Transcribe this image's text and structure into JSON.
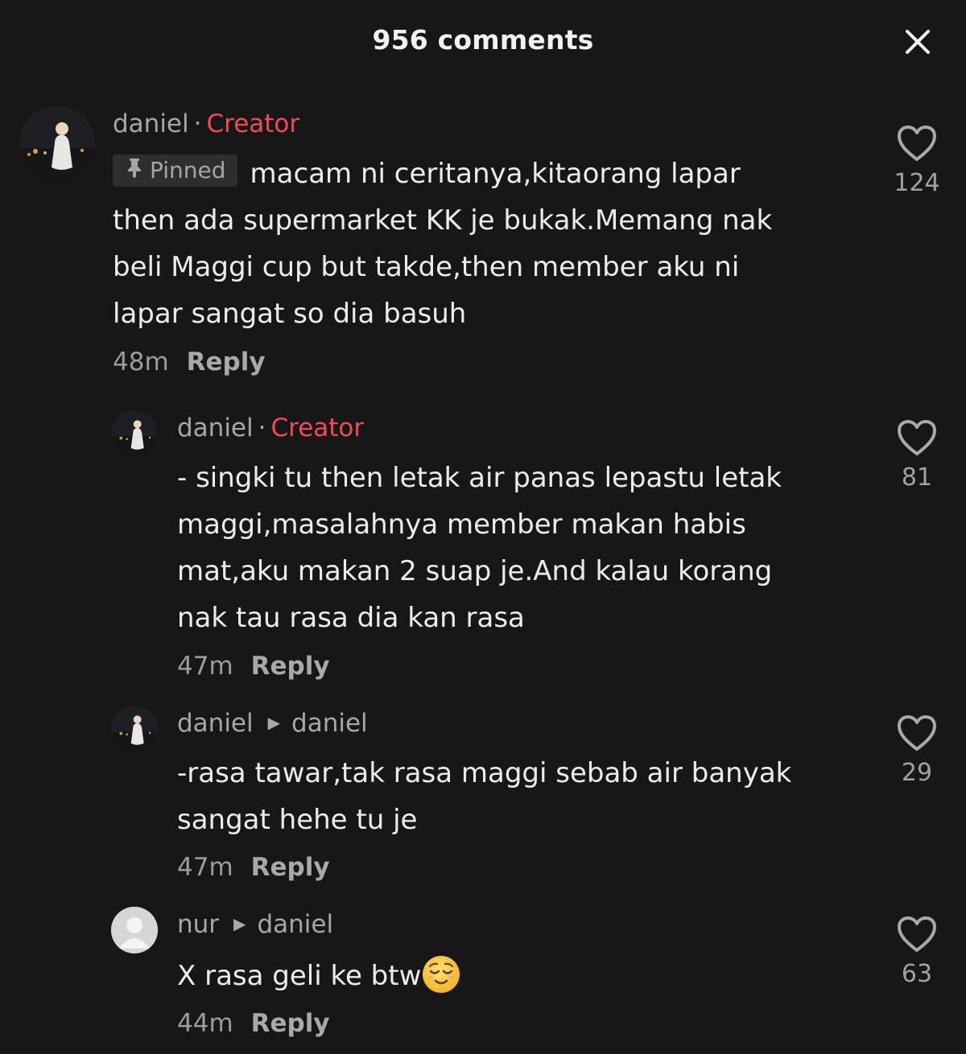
{
  "header": {
    "title": "956 comments",
    "close_icon": "close-icon"
  },
  "comments": [
    {
      "username": "daniel",
      "badge": "Creator",
      "pinned_label": "Pinned",
      "lines": [
        "macam ni ceritanya,kitaorang lapar",
        "then ada supermarket KK je bukak.Memang nak",
        "beli Maggi cup but takde,then member aku ni",
        "lapar sangat so dia basuh"
      ],
      "time": "48m",
      "reply_label": "Reply",
      "likes": "124"
    },
    {
      "username": "daniel",
      "badge": "Creator",
      "lines": [
        "- singki tu then letak air panas lepastu letak",
        "maggi,masalahnya member makan habis",
        "mat,aku makan 2 suap je.And kalau korang",
        "nak tau rasa dia kan rasa"
      ],
      "time": "47m",
      "reply_label": "Reply",
      "likes": "81"
    },
    {
      "username": "daniel",
      "reply_to": "daniel",
      "lines": [
        "-rasa tawar,tak rasa maggi sebab air banyak",
        "sangat hehe tu je"
      ],
      "time": "47m",
      "reply_label": "Reply",
      "likes": "29"
    },
    {
      "username": "nur",
      "reply_to": "daniel",
      "lines": [
        "X rasa geli ke btw"
      ],
      "emoji": "relieved-face-emoji",
      "time": "44m",
      "reply_label": "Reply",
      "likes": "63"
    }
  ],
  "colors": {
    "background": "#171717",
    "creator": "#f04a5a",
    "muted": "#a7a7a7"
  }
}
